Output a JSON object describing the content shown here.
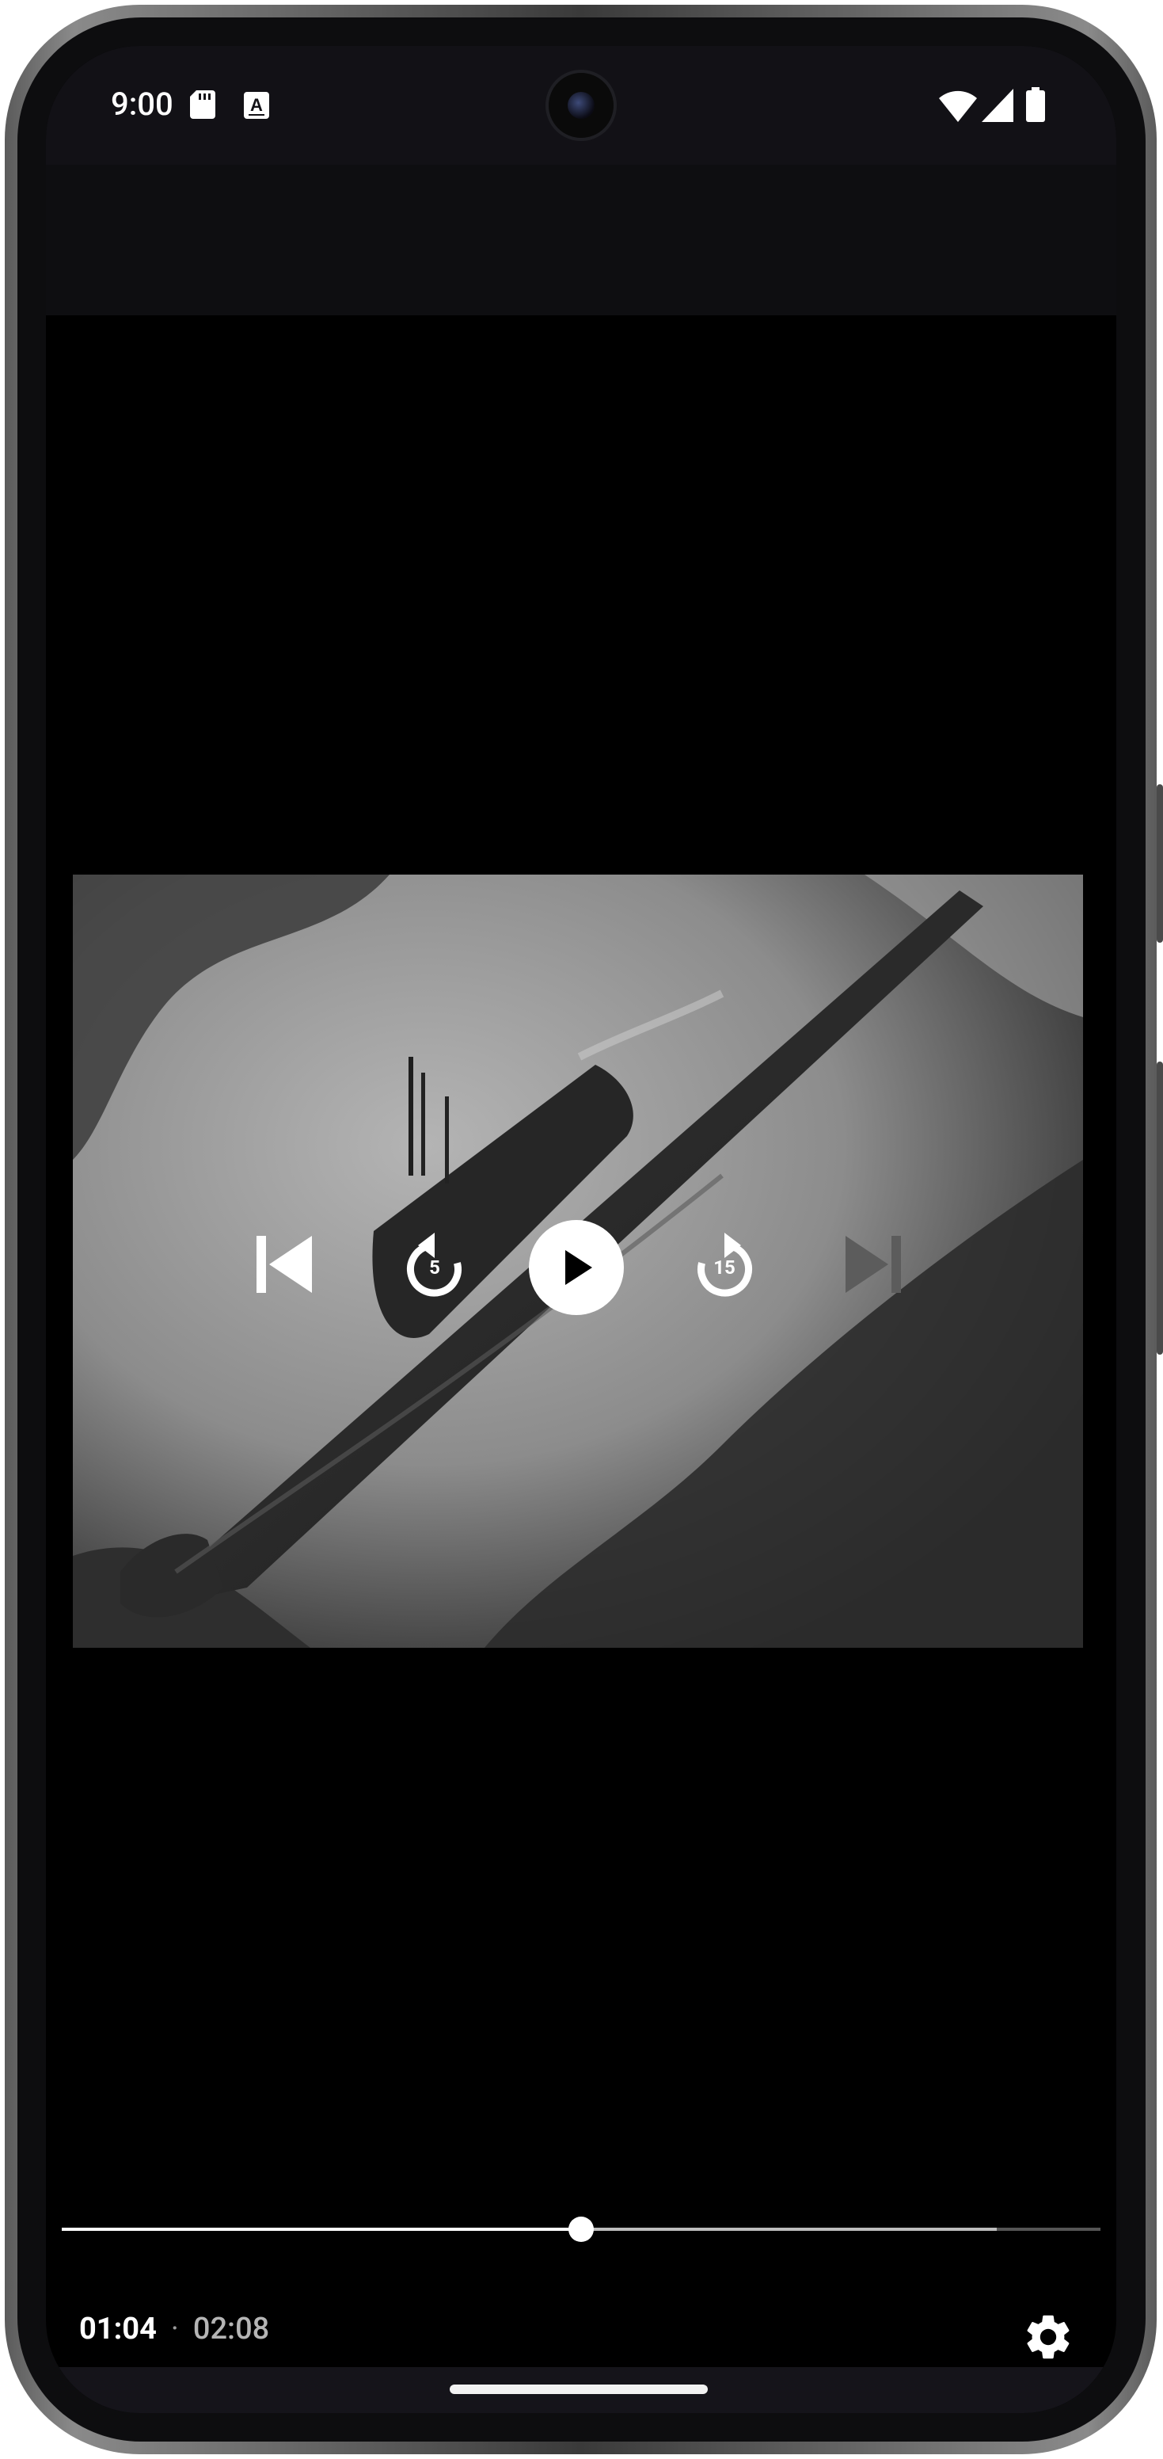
{
  "status_bar": {
    "time": "9:00",
    "icons": [
      "sd-card-icon",
      "text-a-icon",
      "wifi-icon",
      "cell-signal-icon",
      "battery-icon"
    ]
  },
  "player": {
    "controls": [
      "skip-previous-icon",
      "rewind-5-icon",
      "play-icon",
      "forward-15-icon",
      "skip-next-icon"
    ],
    "rewind_seconds": "5",
    "forward_seconds": "15",
    "skip_next_enabled": false,
    "time_current": "01:04",
    "time_separator": "·",
    "time_total": "02:08",
    "progress_fraction": 0.5,
    "buffered_fraction": 0.9,
    "settings_icon": "gear-icon"
  },
  "colors": {
    "screen_bg": "#000000",
    "status_bar_bg": "#121116",
    "top_bar_bg": "#0e0e11",
    "accent": "#ffffff",
    "disabled_icon": "#5c5c5c"
  }
}
